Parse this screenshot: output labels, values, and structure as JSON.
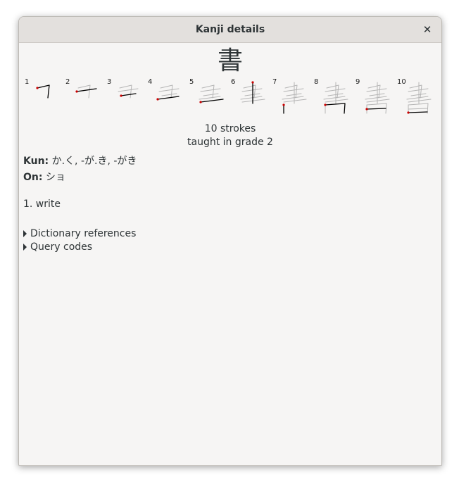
{
  "window": {
    "title": "Kanji details"
  },
  "kanji": {
    "character": "書",
    "stroke_numbers": [
      "1",
      "2",
      "3",
      "4",
      "5",
      "6",
      "7",
      "8",
      "9",
      "10"
    ],
    "stroke_count": "10 strokes",
    "grade": "taught in grade 2"
  },
  "readings": {
    "kun_label": "Kun:",
    "kun_value": " か.く, -が.き, -がき",
    "on_label": "On:",
    "on_value": " ショ"
  },
  "meanings": [
    "1. write"
  ],
  "expanders": [
    "Dictionary references",
    "Query codes"
  ],
  "colors": {
    "current_stroke": "#000000",
    "previous_stroke": "#b5b5b5",
    "start_dot": "#cc0000"
  }
}
